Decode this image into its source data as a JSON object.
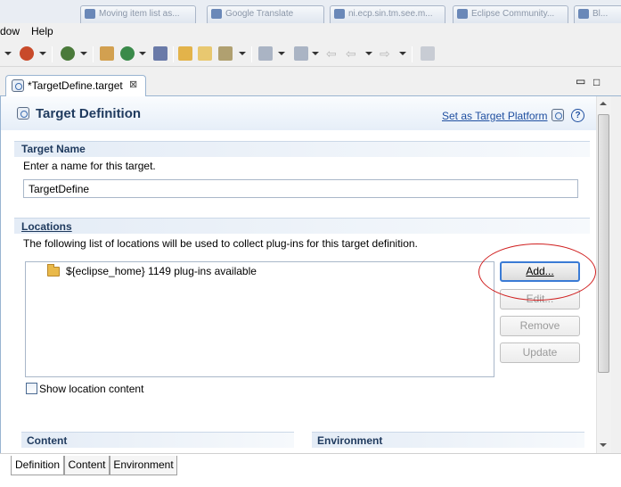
{
  "taskbar": {
    "items": [
      "Moving item list as...",
      "Google Translate",
      "ni.ecp.sin.tm.see.m...",
      "Eclipse Community...",
      "Bl..."
    ]
  },
  "menubar": {
    "items": [
      "dow",
      "Help"
    ]
  },
  "editor_tab": {
    "label": "*TargetDefine.target",
    "close": "⊠"
  },
  "form": {
    "title": "Target Definition",
    "set_platform_link": "Set as Target Platform",
    "help": "?"
  },
  "target_name_section": {
    "title": "Target Name",
    "description": "Enter a name for this target.",
    "name_value": "TargetDefine"
  },
  "locations_section": {
    "title": "Locations",
    "description": "The following list of locations will be used to collect plug-ins for this target definition.",
    "items": [
      {
        "label": "${eclipse_home} 1149 plug-ins available"
      }
    ],
    "buttons": {
      "add": "Add...",
      "edit": "Edit...",
      "remove": "Remove",
      "update": "Update"
    },
    "show_content_label": "Show location content",
    "show_content_checked": false
  },
  "lower_sections": {
    "content": "Content",
    "environment": "Environment"
  },
  "page_tabs": [
    "Definition",
    "Content",
    "Environment"
  ],
  "window_controls": {
    "minimize": "▭",
    "maximize": "□"
  },
  "colors": {
    "section_title": "#1f3a5e",
    "link": "#1f4fa0",
    "highlight_ring": "#d02020"
  }
}
